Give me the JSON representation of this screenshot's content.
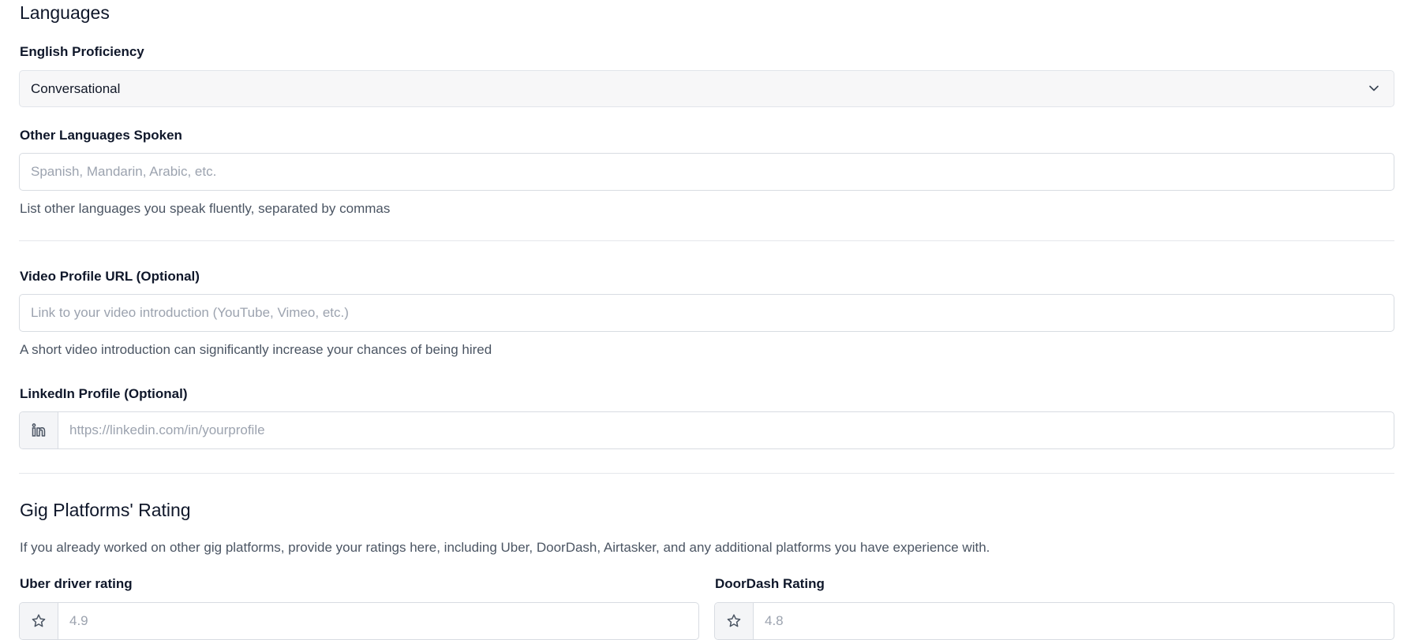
{
  "languages": {
    "heading": "Languages",
    "english_label": "English Proficiency",
    "english_value": "Conversational",
    "other_label": "Other Languages Spoken",
    "other_placeholder": "Spanish, Mandarin, Arabic, etc.",
    "other_help": "List other languages you speak fluently, separated by commas"
  },
  "video": {
    "label": "Video Profile URL (Optional)",
    "placeholder": "Link to your video introduction (YouTube, Vimeo, etc.)",
    "help": "A short video introduction can significantly increase your chances of being hired"
  },
  "linkedin": {
    "label": "LinkedIn Profile (Optional)",
    "placeholder": "https://linkedin.com/in/yourprofile",
    "icon": "linkedin-icon"
  },
  "gig": {
    "heading": "Gig Platforms' Rating",
    "description": "If you already worked on other gig platforms, provide your ratings here, including Uber, DoorDash, Airtasker, and any additional platforms you have experience with.",
    "uber_label": "Uber driver rating",
    "uber_placeholder": "4.9",
    "doordash_label": "DoorDash Rating",
    "doordash_placeholder": "4.8",
    "icon": "star-icon"
  }
}
